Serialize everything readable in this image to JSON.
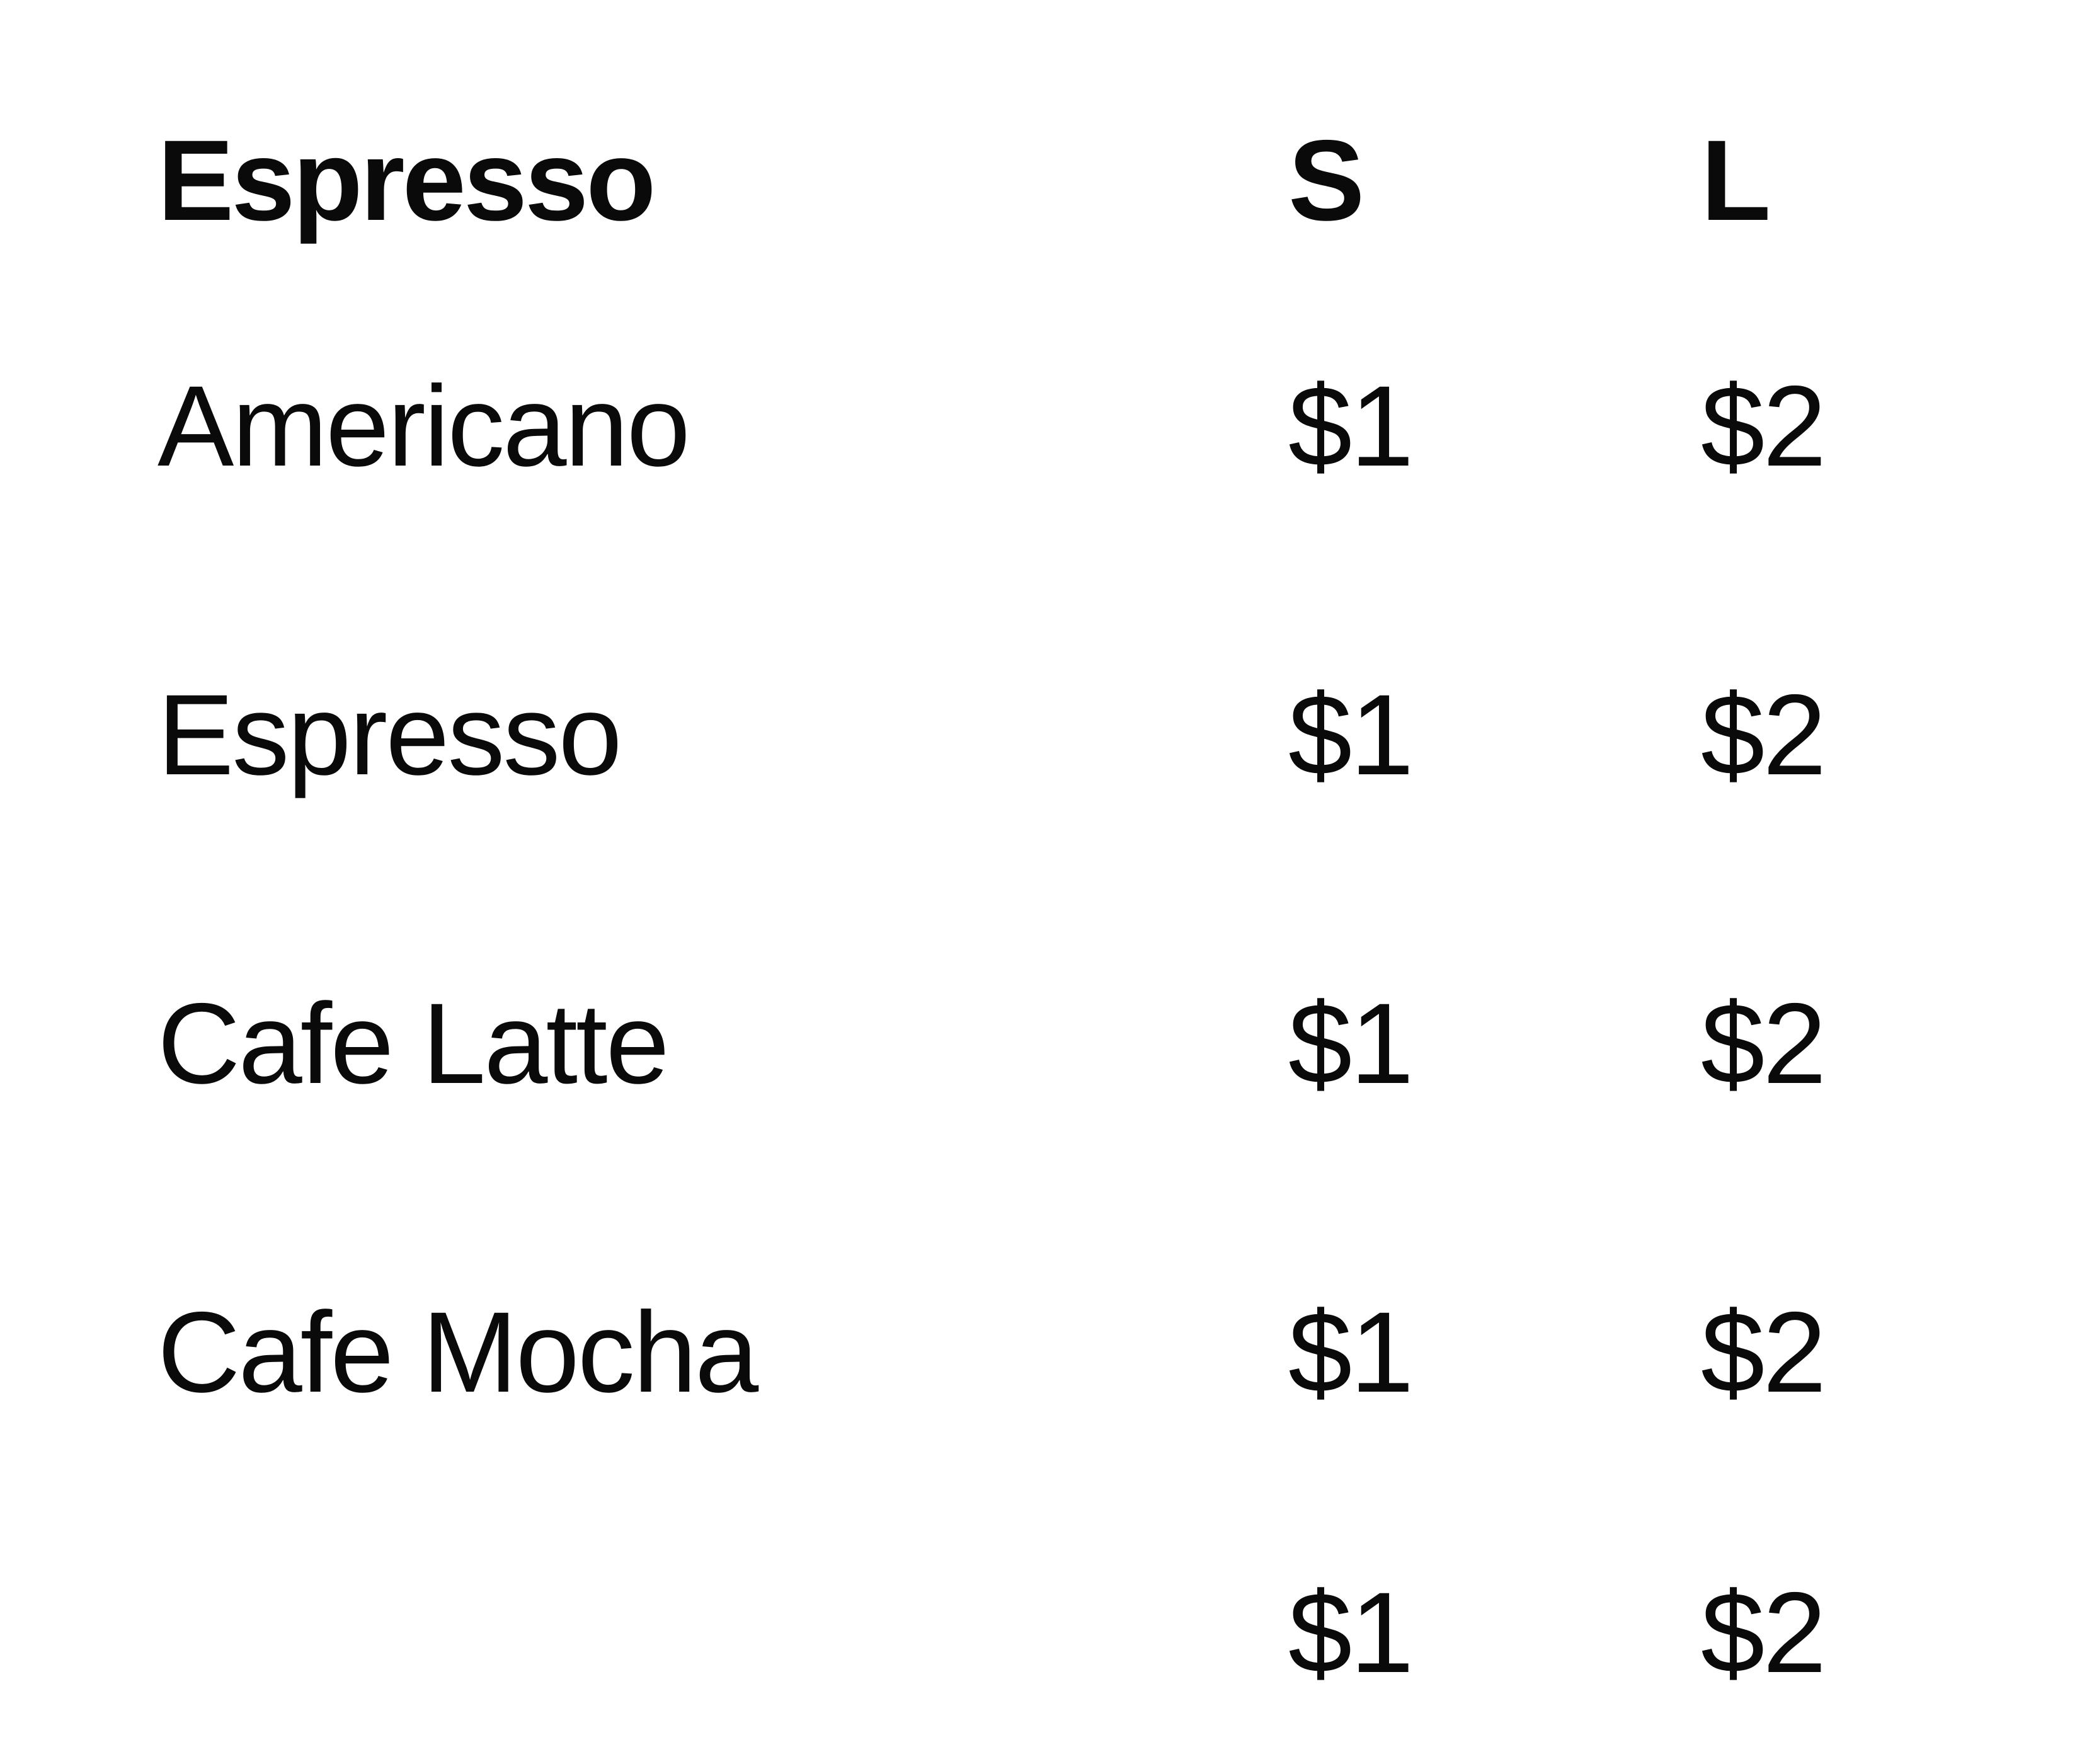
{
  "menu": {
    "header": {
      "category": "Espresso",
      "size_small": "S",
      "size_large": "L"
    },
    "items": [
      {
        "name": "Americano",
        "price_small": "$1",
        "price_large": "$2"
      },
      {
        "name": "Espresso",
        "price_small": "$1",
        "price_large": "$2"
      },
      {
        "name": "Cafe Latte",
        "price_small": "$1",
        "price_large": "$2"
      },
      {
        "name": "Cafe Mocha",
        "price_small": "$1",
        "price_large": "$2"
      },
      {
        "name": "",
        "price_small": "$1",
        "price_large": "$2"
      }
    ]
  }
}
